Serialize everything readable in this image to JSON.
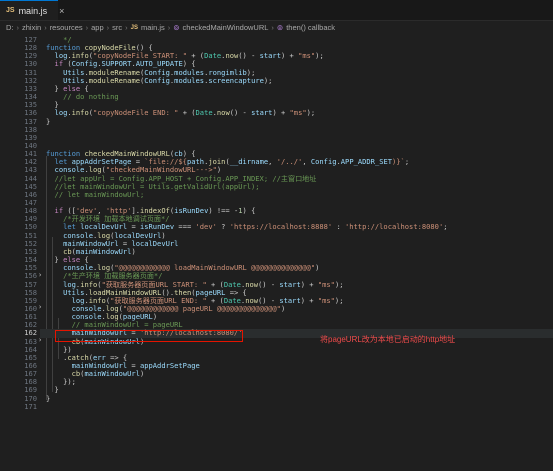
{
  "tab": {
    "icon": "JS",
    "filename": "main.js",
    "close": "×"
  },
  "breadcrumb": {
    "parts": [
      "D:",
      "zhixin",
      "resources",
      "app",
      "src"
    ],
    "file_icon": "JS",
    "file": "main.js",
    "fn1": "checkedMainWindowURL",
    "fn2": "then() callback"
  },
  "annotation": "将pageURL改为本地已启动的http地址",
  "lines": [
    {
      "n": "127",
      "h": [
        [
          "    ",
          "p"
        ],
        [
          "*/",
          "cm"
        ]
      ]
    },
    {
      "n": "128",
      "h": [
        [
          "function ",
          "k"
        ],
        [
          "copyNodeFile",
          "f"
        ],
        [
          "() {",
          "p"
        ]
      ]
    },
    {
      "n": "129",
      "h": [
        [
          "  ",
          "p"
        ],
        [
          "log",
          "v"
        ],
        [
          ".",
          "p"
        ],
        [
          "info",
          "f"
        ],
        [
          "(",
          "p"
        ],
        [
          "\"copyNodeFile START: \"",
          "s"
        ],
        [
          " + (",
          "p"
        ],
        [
          "Date",
          "t"
        ],
        [
          ".",
          "p"
        ],
        [
          "now",
          "f"
        ],
        [
          "() - ",
          "p"
        ],
        [
          "start",
          "v"
        ],
        [
          ") + ",
          "p"
        ],
        [
          "\"ms\"",
          "s"
        ],
        [
          ");",
          "p"
        ]
      ]
    },
    {
      "n": "130",
      "h": [
        [
          "  ",
          "p"
        ],
        [
          "if",
          "c"
        ],
        [
          " (",
          "p"
        ],
        [
          "Config",
          "v"
        ],
        [
          ".",
          "p"
        ],
        [
          "SUPPORT",
          "v"
        ],
        [
          ".",
          "p"
        ],
        [
          "AUTO_UPDATE",
          "v"
        ],
        [
          ") {",
          "p"
        ]
      ]
    },
    {
      "n": "131",
      "h": [
        [
          "    ",
          "p"
        ],
        [
          "Utils",
          "v"
        ],
        [
          ".",
          "p"
        ],
        [
          "moduleRename",
          "f"
        ],
        [
          "(",
          "p"
        ],
        [
          "Config",
          "v"
        ],
        [
          ".",
          "p"
        ],
        [
          "modules",
          "v"
        ],
        [
          ".",
          "p"
        ],
        [
          "rongimlib",
          "v"
        ],
        [
          ");",
          "p"
        ]
      ]
    },
    {
      "n": "132",
      "h": [
        [
          "    ",
          "p"
        ],
        [
          "Utils",
          "v"
        ],
        [
          ".",
          "p"
        ],
        [
          "moduleRename",
          "f"
        ],
        [
          "(",
          "p"
        ],
        [
          "Config",
          "v"
        ],
        [
          ".",
          "p"
        ],
        [
          "modules",
          "v"
        ],
        [
          ".",
          "p"
        ],
        [
          "screencapture",
          "v"
        ],
        [
          ");",
          "p"
        ]
      ]
    },
    {
      "n": "133",
      "h": [
        [
          "  } ",
          "p"
        ],
        [
          "else",
          "c"
        ],
        [
          " {",
          "p"
        ]
      ]
    },
    {
      "n": "134",
      "h": [
        [
          "    ",
          "p"
        ],
        [
          "// do nothing",
          "cm"
        ]
      ]
    },
    {
      "n": "135",
      "h": [
        [
          "  }",
          "p"
        ]
      ]
    },
    {
      "n": "136",
      "h": [
        [
          "  ",
          "p"
        ],
        [
          "log",
          "v"
        ],
        [
          ".",
          "p"
        ],
        [
          "info",
          "f"
        ],
        [
          "(",
          "p"
        ],
        [
          "\"copyNodeFile END: \"",
          "s"
        ],
        [
          " + (",
          "p"
        ],
        [
          "Date",
          "t"
        ],
        [
          ".",
          "p"
        ],
        [
          "now",
          "f"
        ],
        [
          "() - ",
          "p"
        ],
        [
          "start",
          "v"
        ],
        [
          ") + ",
          "p"
        ],
        [
          "\"ms\"",
          "s"
        ],
        [
          ");",
          "p"
        ]
      ]
    },
    {
      "n": "137",
      "h": [
        [
          "}",
          "p"
        ]
      ]
    },
    {
      "n": "138",
      "h": []
    },
    {
      "n": "139",
      "h": []
    },
    {
      "n": "140",
      "h": []
    },
    {
      "n": "141",
      "h": [
        [
          "function ",
          "k"
        ],
        [
          "checkedMainWindowURL",
          "f"
        ],
        [
          "(",
          "p"
        ],
        [
          "cb",
          "v"
        ],
        [
          ") {",
          "p"
        ]
      ]
    },
    {
      "n": "142",
      "h": [
        [
          "  ",
          "p"
        ],
        [
          "let ",
          "k"
        ],
        [
          "appAddrSetPage",
          "v"
        ],
        [
          " = ",
          "p"
        ],
        [
          "`file://${",
          "s"
        ],
        [
          "path",
          "v"
        ],
        [
          ".",
          "p"
        ],
        [
          "join",
          "f"
        ],
        [
          "(",
          "p"
        ],
        [
          "__dirname",
          "v"
        ],
        [
          ", ",
          "p"
        ],
        [
          "'/../'",
          "s"
        ],
        [
          ", ",
          "p"
        ],
        [
          "Config",
          "v"
        ],
        [
          ".",
          "p"
        ],
        [
          "APP_ADDR_SET",
          "v"
        ],
        [
          ")}`",
          "s"
        ],
        [
          ";",
          "p"
        ]
      ]
    },
    {
      "n": "143",
      "h": [
        [
          "  ",
          "p"
        ],
        [
          "console",
          "v"
        ],
        [
          ".",
          "p"
        ],
        [
          "log",
          "f"
        ],
        [
          "(",
          "p"
        ],
        [
          "\"checkedMainWindowURL--->\"",
          "s"
        ],
        [
          ")",
          "p"
        ]
      ]
    },
    {
      "n": "144",
      "h": [
        [
          "  ",
          "p"
        ],
        [
          "//let appUrl = Config.APP_HOST + Config.APP_INDEX; //主窗口地址",
          "cm"
        ]
      ]
    },
    {
      "n": "145",
      "h": [
        [
          "  ",
          "p"
        ],
        [
          "//let mainWindowUrl = Utils.getValidUrl(appUrl);",
          "cm"
        ]
      ]
    },
    {
      "n": "146",
      "h": [
        [
          "  ",
          "p"
        ],
        [
          "// let mainWindowUrl;",
          "cm"
        ]
      ]
    },
    {
      "n": "147",
      "h": []
    },
    {
      "n": "148",
      "h": [
        [
          "  ",
          "p"
        ],
        [
          "if",
          "c"
        ],
        [
          " ([",
          "p"
        ],
        [
          "'dev'",
          "s"
        ],
        [
          ", ",
          "p"
        ],
        [
          "'http'",
          "s"
        ],
        [
          "].",
          "p"
        ],
        [
          "indexOf",
          "f"
        ],
        [
          "(",
          "p"
        ],
        [
          "isRunDev",
          "v"
        ],
        [
          ") !== -",
          "p"
        ],
        [
          "1",
          "n"
        ],
        [
          ") {",
          "p"
        ]
      ]
    },
    {
      "n": "149",
      "h": [
        [
          "    ",
          "p"
        ],
        [
          "/*开发环境 加载本地调试页面*/",
          "cm"
        ]
      ]
    },
    {
      "n": "150",
      "h": [
        [
          "    ",
          "p"
        ],
        [
          "let ",
          "k"
        ],
        [
          "localDevUrl",
          "v"
        ],
        [
          " = ",
          "p"
        ],
        [
          "isRunDev",
          "v"
        ],
        [
          " === ",
          "p"
        ],
        [
          "'dev'",
          "s"
        ],
        [
          " ? ",
          "p"
        ],
        [
          "'https://localhost:8888'",
          "s"
        ],
        [
          " : ",
          "p"
        ],
        [
          "'http://localhost:8080'",
          "s"
        ],
        [
          ";",
          "p"
        ]
      ]
    },
    {
      "n": "151",
      "h": [
        [
          "    ",
          "p"
        ],
        [
          "console",
          "v"
        ],
        [
          ".",
          "p"
        ],
        [
          "log",
          "f"
        ],
        [
          "(",
          "p"
        ],
        [
          "localDevUrl",
          "v"
        ],
        [
          ")",
          "p"
        ]
      ]
    },
    {
      "n": "152",
      "h": [
        [
          "    ",
          "p"
        ],
        [
          "mainWindowUrl",
          "v"
        ],
        [
          " = ",
          "p"
        ],
        [
          "localDevUrl",
          "v"
        ]
      ]
    },
    {
      "n": "153",
      "h": [
        [
          "    ",
          "p"
        ],
        [
          "cb",
          "f"
        ],
        [
          "(",
          "p"
        ],
        [
          "mainWindowUrl",
          "v"
        ],
        [
          ")",
          "p"
        ]
      ]
    },
    {
      "n": "154",
      "h": [
        [
          "  } ",
          "p"
        ],
        [
          "else",
          "c"
        ],
        [
          " {",
          "p"
        ]
      ]
    },
    {
      "n": "155",
      "h": [
        [
          "    ",
          "p"
        ],
        [
          "console",
          "v"
        ],
        [
          ".",
          "p"
        ],
        [
          "log",
          "f"
        ],
        [
          "(",
          "p"
        ],
        [
          "\"@@@@@@@@@@@@ loadMainWindowURL @@@@@@@@@@@@@@\"",
          "s"
        ],
        [
          ")",
          "p"
        ]
      ]
    },
    {
      "n": "156",
      "h": [
        [
          "    ",
          "p"
        ],
        [
          "/*生产环境 加载服务器页面*/",
          "cm"
        ]
      ]
    },
    {
      "n": "157",
      "h": [
        [
          "    ",
          "p"
        ],
        [
          "log",
          "v"
        ],
        [
          ".",
          "p"
        ],
        [
          "info",
          "f"
        ],
        [
          "(",
          "p"
        ],
        [
          "\"获取服务器页面URL START: \"",
          "s"
        ],
        [
          " + (",
          "p"
        ],
        [
          "Date",
          "t"
        ],
        [
          ".",
          "p"
        ],
        [
          "now",
          "f"
        ],
        [
          "() - ",
          "p"
        ],
        [
          "start",
          "v"
        ],
        [
          ") + ",
          "p"
        ],
        [
          "\"ms\"",
          "s"
        ],
        [
          ");",
          "p"
        ]
      ]
    },
    {
      "n": "158",
      "h": [
        [
          "    ",
          "p"
        ],
        [
          "Utils",
          "v"
        ],
        [
          ".",
          "p"
        ],
        [
          "loadMainWindowURL",
          "f"
        ],
        [
          "().",
          "p"
        ],
        [
          "then",
          "f"
        ],
        [
          "(",
          "p"
        ],
        [
          "pageURL",
          "v"
        ],
        [
          " => {",
          "p"
        ]
      ]
    },
    {
      "n": "159",
      "h": [
        [
          "      ",
          "p"
        ],
        [
          "log",
          "v"
        ],
        [
          ".",
          "p"
        ],
        [
          "info",
          "f"
        ],
        [
          "(",
          "p"
        ],
        [
          "\"获取服务器页面URL END: \"",
          "s"
        ],
        [
          " + (",
          "p"
        ],
        [
          "Date",
          "t"
        ],
        [
          ".",
          "p"
        ],
        [
          "now",
          "f"
        ],
        [
          "() - ",
          "p"
        ],
        [
          "start",
          "v"
        ],
        [
          ") + ",
          "p"
        ],
        [
          "\"ms\"",
          "s"
        ],
        [
          ");",
          "p"
        ]
      ]
    },
    {
      "n": "160",
      "h": [
        [
          "      ",
          "p"
        ],
        [
          "console",
          "v"
        ],
        [
          ".",
          "p"
        ],
        [
          "log",
          "f"
        ],
        [
          "(",
          "p"
        ],
        [
          "\"@@@@@@@@@@@@ pageURL @@@@@@@@@@@@@@\"",
          "s"
        ],
        [
          ")",
          "p"
        ]
      ]
    },
    {
      "n": "161",
      "h": [
        [
          "      ",
          "p"
        ],
        [
          "console",
          "v"
        ],
        [
          ".",
          "p"
        ],
        [
          "log",
          "f"
        ],
        [
          "(",
          "p"
        ],
        [
          "pageURL",
          "v"
        ],
        [
          ")",
          "p"
        ]
      ]
    },
    {
      "n": "162",
      "h": [
        [
          "      ",
          "p"
        ],
        [
          "// mainWindowUrl = pageURL",
          "cm"
        ]
      ]
    },
    {
      "n": "162",
      "h": [
        [
          "      ",
          "p"
        ],
        [
          "mainWindowUrl",
          "v"
        ],
        [
          " = ",
          "p"
        ],
        [
          "'http://localhost:8080/'",
          "s"
        ]
      ],
      "active": true
    },
    {
      "n": "163",
      "h": [
        [
          "      ",
          "p"
        ],
        [
          "cb",
          "f"
        ],
        [
          "(",
          "p"
        ],
        [
          "mainWindowUrl",
          "v"
        ],
        [
          ")",
          "p"
        ]
      ]
    },
    {
      "n": "164",
      "h": [
        [
          "    ",
          "p"
        ],
        [
          "})",
          "p"
        ]
      ]
    },
    {
      "n": "165",
      "h": [
        [
          "    .",
          "p"
        ],
        [
          "catch",
          "f"
        ],
        [
          "(",
          "p"
        ],
        [
          "err",
          "v"
        ],
        [
          " => {",
          "p"
        ]
      ]
    },
    {
      "n": "166",
      "h": [
        [
          "      ",
          "p"
        ],
        [
          "mainWindowUrl",
          "v"
        ],
        [
          " = ",
          "p"
        ],
        [
          "appAddrSetPage",
          "v"
        ]
      ]
    },
    {
      "n": "167",
      "h": [
        [
          "      ",
          "p"
        ],
        [
          "cb",
          "f"
        ],
        [
          "(",
          "p"
        ],
        [
          "mainWindowUrl",
          "v"
        ],
        [
          ")",
          "p"
        ]
      ]
    },
    {
      "n": "168",
      "h": [
        [
          "    ",
          "p"
        ],
        [
          "});",
          "p"
        ]
      ]
    },
    {
      "n": "169",
      "h": [
        [
          "  }",
          "p"
        ]
      ]
    },
    {
      "n": "170",
      "h": [
        [
          "}",
          "p"
        ]
      ]
    },
    {
      "n": "171",
      "h": []
    }
  ]
}
